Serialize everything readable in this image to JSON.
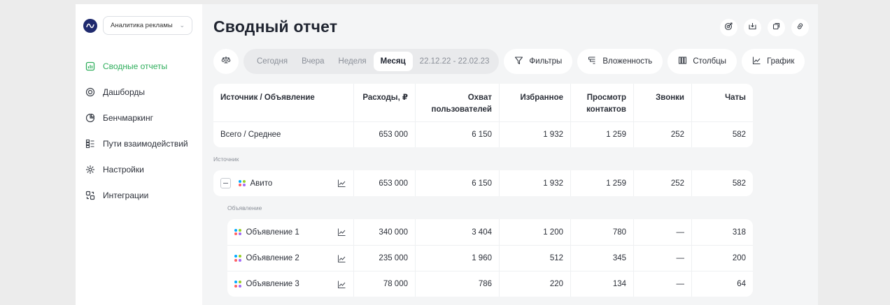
{
  "app": {
    "selector_value": "Аналитика рекламы"
  },
  "nav": {
    "items": [
      {
        "label": "Сводные отчеты",
        "icon": "report-icon",
        "active": true
      },
      {
        "label": "Дашборды",
        "icon": "dashboard-icon",
        "active": false
      },
      {
        "label": "Бенчмаркинг",
        "icon": "pie-chart-icon",
        "active": false
      },
      {
        "label": "Пути взаимодействий",
        "icon": "paths-icon",
        "active": false
      },
      {
        "label": "Настройки",
        "icon": "gear-icon",
        "active": false
      },
      {
        "label": "Интеграции",
        "icon": "integrations-icon",
        "active": false
      }
    ]
  },
  "page": {
    "title": "Сводный отчет",
    "actions": [
      "target-icon",
      "download-icon",
      "copy-icon",
      "link-icon"
    ]
  },
  "toolbar": {
    "periods": [
      "Сегодня",
      "Вчера",
      "Неделя",
      "Месяц"
    ],
    "active_period": "Месяц",
    "date_range": "22.12.22 - 22.02.23",
    "filters_label": "Фильтры",
    "nesting_label": "Вложенность",
    "columns_label": "Столбцы",
    "chart_label": "График"
  },
  "table": {
    "headers": [
      "Источник / Объявление",
      "Расходы, ₽",
      "Охват пользователей",
      "Избранное",
      "Просмотр контактов",
      "Звонки",
      "Чаты"
    ],
    "total": [
      "Всего / Среднее",
      "653 000",
      "6 150",
      "1 932",
      "1 259",
      "252",
      "582"
    ],
    "source_label": "Источник",
    "source": [
      "Авито",
      "653 000",
      "6 150",
      "1 932",
      "1 259",
      "252",
      "582"
    ],
    "ads_label": "Объявление",
    "ads": [
      [
        "Объявление 1",
        "340 000",
        "3 404",
        "1 200",
        "780",
        "—",
        "318"
      ],
      [
        "Объявление 2",
        "235 000",
        "1 960",
        "512",
        "345",
        "—",
        "200"
      ],
      [
        "Объявление 3",
        "78 000",
        "786",
        "220",
        "134",
        "—",
        "64"
      ]
    ]
  },
  "colors": {
    "accent": "#2fae5c",
    "logo": "#1f2a6e",
    "brand_dots": [
      "#00aaff",
      "#97cf26",
      "#ff6163",
      "#a169f7"
    ]
  }
}
